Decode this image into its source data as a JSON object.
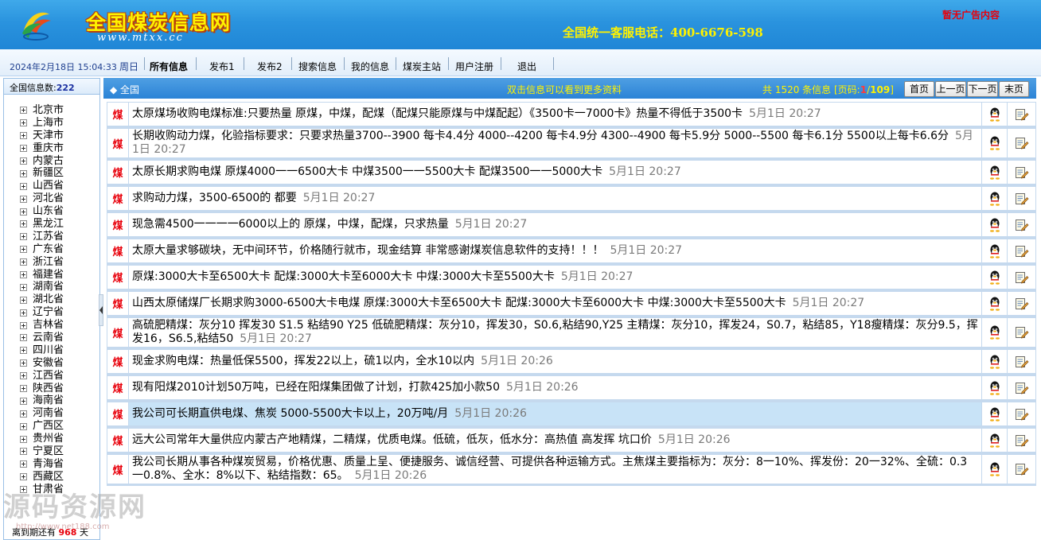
{
  "header": {
    "site_title": "全国煤炭信息网",
    "site_url": "www.mtxx.cc",
    "hotline": "全国统一客服电话：400-6676-598",
    "ad_text": "暂无广告内容"
  },
  "nav": {
    "date_time": "2024年2月18日  15:04:33",
    "weekday": "周日",
    "items": [
      {
        "label": "所有信息",
        "active": true
      },
      {
        "label": "发布1",
        "active": false
      },
      {
        "label": "发布2",
        "active": false
      },
      {
        "label": "搜索信息",
        "active": false
      },
      {
        "label": "我的信息",
        "active": false
      },
      {
        "label": "煤炭主站",
        "active": false
      },
      {
        "label": "用户注册",
        "active": false
      },
      {
        "label": "退出",
        "active": false
      }
    ]
  },
  "sidebar": {
    "header_label": "全国信息数:",
    "count": "222",
    "provinces": [
      "北京市",
      "上海市",
      "天津市",
      "重庆市",
      "内蒙古",
      "新疆区",
      "山西省",
      "河北省",
      "山东省",
      "黑龙江",
      "江苏省",
      "广东省",
      "浙江省",
      "福建省",
      "湖南省",
      "湖北省",
      "辽宁省",
      "吉林省",
      "云南省",
      "四川省",
      "安徽省",
      "江西省",
      "陕西省",
      "海南省",
      "河南省",
      "广西区",
      "贵州省",
      "宁夏区",
      "青海省",
      "西藏区",
      "甘肃省"
    ],
    "footer_prefix": "离到期还有",
    "days_left": "968",
    "footer_suffix": "天",
    "watermark": "源码资源网",
    "watermark_url": "http://www.net188.com"
  },
  "main": {
    "region_label": "◆ 全国",
    "hint": "双击信息可以看到更多资料",
    "total_prefix": "共 1520 条信息",
    "page_prefix": "[页码:",
    "page_current": "1",
    "page_sep": "/",
    "page_total": "109",
    "page_suffix": "]",
    "pager": [
      "首页",
      "上一页",
      "下一页",
      "末页"
    ],
    "tag": "煤",
    "rows": [
      {
        "text": "太原煤场收购电煤标准:只要热量 原煤，中煤，配煤（配煤只能原煤与中煤配起）《3500卡一7000卡》热量不得低于3500卡",
        "time": "5月1日  20:27",
        "highlight": false
      },
      {
        "text": "长期收购动力煤，化验指标要求：只要求热量3700--3900 每卡4.4分 4000--4200 每卡4.9分 4300--4900 每卡5.9分 5000--5500 每卡6.1分 5500以上每卡6.6分",
        "time": "5月1日  20:27",
        "highlight": false
      },
      {
        "text": "太原长期求购电煤 原煤4000一一6500大卡 中煤3500一一5500大卡 配煤3500一一5000大卡",
        "time": "5月1日  20:27",
        "highlight": false
      },
      {
        "text": "求购动力煤，3500-6500的 都要",
        "time": "5月1日  20:27",
        "highlight": false
      },
      {
        "text": "现急需4500一一一一6000以上的 原煤，中煤，配煤，只求热量",
        "time": "5月1日  20:27",
        "highlight": false
      },
      {
        "text": "太原大量求够碳块，无中间环节，价格随行就市，现金结算 非常感谢煤炭信息软件的支持！！！",
        "time": "5月1日  20:27",
        "highlight": false
      },
      {
        "text": "原煤:3000大卡至6500大卡 配煤:3000大卡至6000大卡 中煤:3000大卡至5500大卡",
        "time": "5月1日  20:27",
        "highlight": false
      },
      {
        "text": "山西太原储煤厂长期求购3000-6500大卡电煤 原煤:3000大卡至6500大卡 配煤:3000大卡至6000大卡 中煤:3000大卡至5500大卡",
        "time": "5月1日  20:27",
        "highlight": false
      },
      {
        "text": "高硫肥精煤：灰分10 挥发30 S1.5 粘结90 Y25 低硫肥精煤：灰分10，挥发30，S0.6,粘结90,Y25 主精煤：灰分10，挥发24，S0.7，粘结85，Y18瘦精煤：灰分9.5，挥发16，S6.5,粘结50",
        "time": "5月1日  20:27",
        "highlight": false
      },
      {
        "text": "现金求购电煤：热量低保5500，挥发22以上，硫1以内，全水10以内",
        "time": "5月1日  20:26",
        "highlight": false
      },
      {
        "text": "现有阳煤2010计划50万吨，已经在阳煤集团做了计划，打款425加小款50",
        "time": "5月1日  20:26",
        "highlight": false
      },
      {
        "text": "我公司可长期直供电煤、焦炭 5000-5500大卡以上，20万吨/月",
        "time": "5月1日  20:26",
        "highlight": true
      },
      {
        "text": "远大公司常年大量供应内蒙古产地精煤，二精煤，优质电煤。低硫，低灰，低水分：高热值 高发挥 坑口价",
        "time": "5月1日  20:26",
        "highlight": false
      },
      {
        "text": "我公司长期从事各种煤炭贸易，价格优惠、质量上呈、便捷服务、诚信经营、可提供各种运输方式。主焦煤主要指标为：灰分：8一10%、挥发份：20一32%、全硫：0.3一0.8%、全水：8%以下、粘结指数：65。",
        "time": "5月1日  20:26",
        "highlight": false
      }
    ]
  },
  "icons": {
    "qq": "qq-penguin-icon",
    "edit": "edit-note-icon"
  },
  "colors": {
    "header_blue": "#2a93de",
    "title_yellow": "#fff200",
    "tag_red": "#e8000b",
    "highlight_row": "#c8e3f7"
  }
}
